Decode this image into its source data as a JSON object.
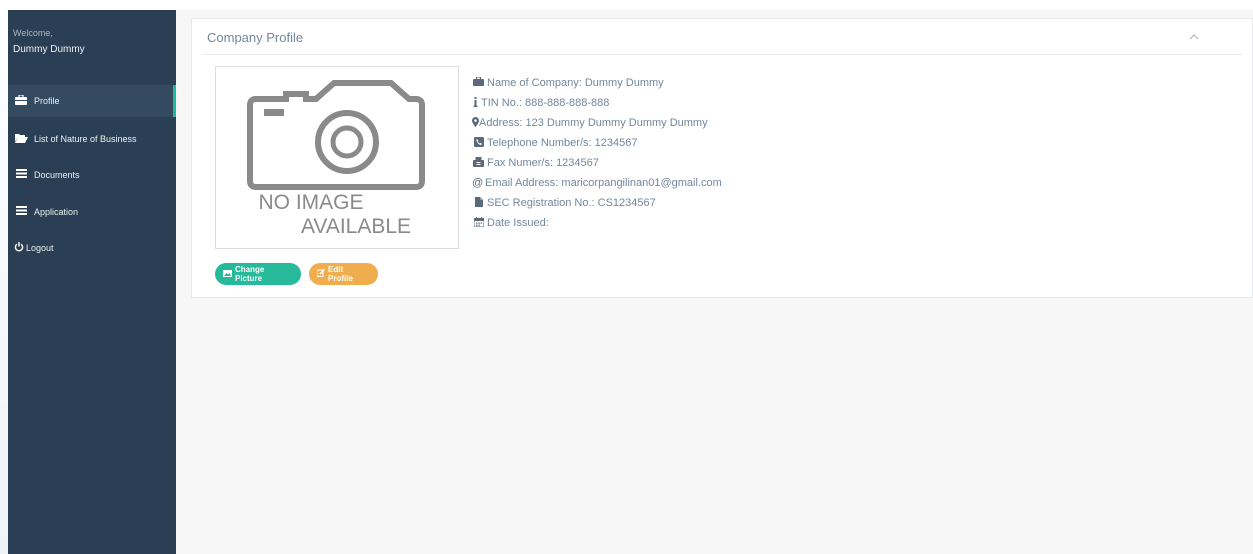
{
  "sidebar": {
    "welcome": "Welcome,",
    "username": "Dummy Dummy",
    "items": [
      {
        "label": "Profile",
        "icon": "briefcase-icon",
        "active": true
      },
      {
        "label": "List of Nature of Business",
        "icon": "folder-open-icon",
        "active": false
      },
      {
        "label": "Documents",
        "icon": "bars-icon",
        "active": false
      },
      {
        "label": "Application",
        "icon": "bars-icon",
        "active": false
      },
      {
        "label": "Logout",
        "icon": "power-icon",
        "active": false
      }
    ]
  },
  "panel": {
    "title": "Company Profile",
    "photo": {
      "line1": "NO IMAGE",
      "line2": "AVAILABLE"
    },
    "info": [
      {
        "icon": "briefcase-icon",
        "text": "Name of Company: Dummy Dummy"
      },
      {
        "icon": "info-icon",
        "text": "TIN No.: 888-888-888-888"
      },
      {
        "icon": "map-marker-icon",
        "text": "Address: 123 Dummy Dummy Dummy Dummy"
      },
      {
        "icon": "phone-icon",
        "text": "Telephone Number/s: 1234567"
      },
      {
        "icon": "fax-icon",
        "text": "Fax Numer/s: 1234567"
      },
      {
        "icon": "at-icon",
        "text": "Email Address: maricorpangilinan01@gmail.com"
      },
      {
        "icon": "file-icon",
        "text": "SEC Registration No.: CS1234567"
      },
      {
        "icon": "calendar-icon",
        "text": "Date Issued:"
      }
    ],
    "buttons": {
      "change_picture": "Change Picture",
      "edit_profile": "Edit Profile"
    }
  },
  "colors": {
    "sidebar_bg": "#2a3f54",
    "accent_green": "#26b99a",
    "accent_orange": "#f0ad4e",
    "text_muted": "#73879c"
  }
}
